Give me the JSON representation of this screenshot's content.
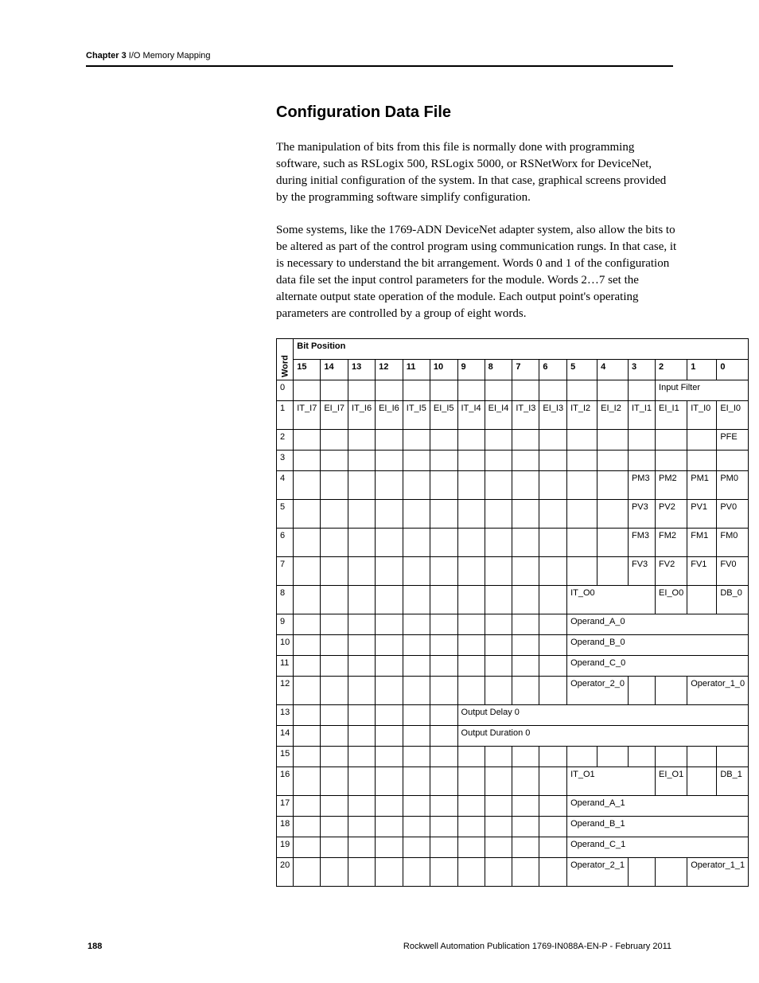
{
  "header": {
    "chapter_bold": "Chapter 3",
    "chapter_rest": " I/O Memory Mapping"
  },
  "section": {
    "title": "Configuration Data File",
    "para1": "The manipulation of bits from this file is normally done with programming software, such as RSLogix 500, RSLogix 5000, or RSNetWorx for DeviceNet, during initial configuration of the system. In that case, graphical screens provided by the programming software simplify configuration.",
    "para2": "Some systems, like the 1769-ADN DeviceNet adapter system, also allow the bits to be altered as part of the control program using communication rungs. In that case, it is necessary to understand the bit arrangement. Words 0 and 1 of the configuration data file set the input control parameters for the module. Words 2…7 set the alternate output state operation of the module. Each output point's operating parameters are controlled by a group of eight words."
  },
  "table": {
    "word_header": "Word",
    "bit_position": "Bit Position",
    "cols": [
      "15",
      "14",
      "13",
      "12",
      "11",
      "10",
      "9",
      "8",
      "7",
      "6",
      "5",
      "4",
      "3",
      "2",
      "1",
      "0"
    ],
    "rows": {
      "r0": {
        "word": "0",
        "input_filter": "Input Filter"
      },
      "r1": {
        "word": "1",
        "cells": [
          "IT_I7",
          "EI_I7",
          "IT_I6",
          "EI_I6",
          "IT_I5",
          "EI_I5",
          "IT_I4",
          "EI_I4",
          "IT_I3",
          "EI_I3",
          "IT_I2",
          "EI_I2",
          "IT_I1",
          "EI_I1",
          "IT_I0",
          "EI_I0"
        ]
      },
      "r2": {
        "word": "2",
        "pfe": "PFE"
      },
      "r3": {
        "word": "3"
      },
      "r4": {
        "word": "4",
        "pm": [
          "PM3",
          "PM2",
          "PM1",
          "PM0"
        ]
      },
      "r5": {
        "word": "5",
        "pv": [
          "PV3",
          "PV2",
          "PV1",
          "PV0"
        ]
      },
      "r6": {
        "word": "6",
        "fm": [
          "FM3",
          "FM2",
          "FM1",
          "FM0"
        ]
      },
      "r7": {
        "word": "7",
        "fv": [
          "FV3",
          "FV2",
          "FV1",
          "FV0"
        ]
      },
      "r8": {
        "word": "8",
        "it": "IT_O0",
        "ei": "EI_O0",
        "db": "DB_0"
      },
      "r9": {
        "word": "9",
        "op": "Operand_A_0"
      },
      "r10": {
        "word": "10",
        "op": "Operand_B_0"
      },
      "r11": {
        "word": "11",
        "op": "Operand_C_0"
      },
      "r12": {
        "word": "12",
        "op2": "Operator_2_0",
        "op1": "Operator_1_0"
      },
      "r13": {
        "word": "13",
        "out": "Output Delay 0"
      },
      "r14": {
        "word": "14",
        "out": "Output Duration 0"
      },
      "r15": {
        "word": "15"
      },
      "r16": {
        "word": "16",
        "it": "IT_O1",
        "ei": "EI_O1",
        "db": "DB_1"
      },
      "r17": {
        "word": "17",
        "op": "Operand_A_1"
      },
      "r18": {
        "word": "18",
        "op": "Operand_B_1"
      },
      "r19": {
        "word": "19",
        "op": "Operand_C_1"
      },
      "r20": {
        "word": "20",
        "op2": "Operator_2_1",
        "op1": "Operator_1_1"
      }
    }
  },
  "footer": {
    "page": "188",
    "publication": "Rockwell Automation Publication 1769-IN088A-EN-P - February 2011"
  }
}
